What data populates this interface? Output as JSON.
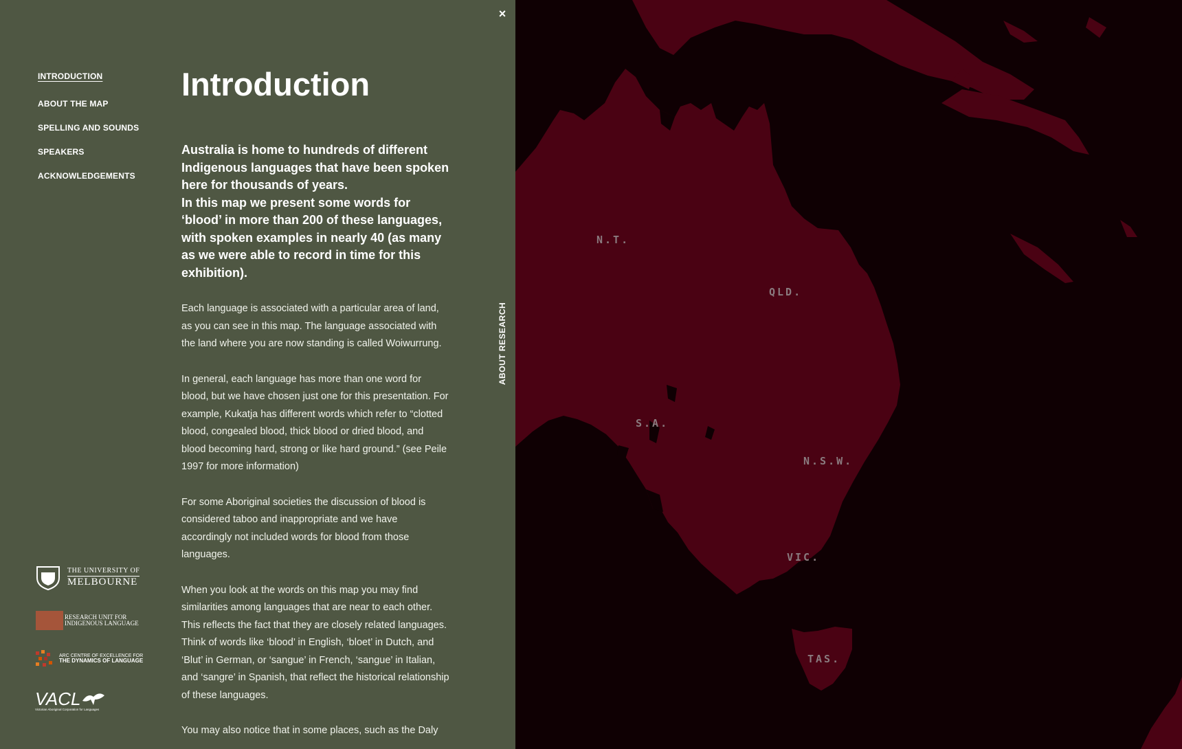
{
  "panel": {
    "close_label": "×",
    "vertical_tab_label": "ABOUT RESEARCH",
    "nav": [
      {
        "label": "INTRODUCTION",
        "active": true
      },
      {
        "label": "ABOUT THE MAP",
        "active": false
      },
      {
        "label": "SPELLING AND SOUNDS",
        "active": false
      },
      {
        "label": "SPEAKERS",
        "active": false
      },
      {
        "label": "ACKNOWLEDGEMENTS",
        "active": false
      }
    ],
    "title": "Introduction",
    "lead": [
      "Australia is home to hundreds of different Indigenous languages that have been spoken here for thousands of years.",
      "In this map we present some words for ‘blood’ in more than 200 of these languages, with spoken examples in nearly 40 (as many as we were able to record in time for this exhibition)."
    ],
    "paragraphs": [
      "Each language is associated with a particular area of land, as you can see in this map. The language associated with the land where you are now standing is called Woiwurrung.",
      "In general, each language has more than one word for blood, but we have chosen just one for this presentation. For example, Kukatja has different words which refer to “clotted blood, congealed blood, thick blood or dried blood, and blood becoming hard, strong or like hard ground.” (see Peile 1997 for more information)",
      "For some Aboriginal societies the discussion of blood is considered taboo and inappropriate and we have accordingly not included words for blood from those languages.",
      "When you look at the words on this map you may find similarities among languages that are near to each other. This reflects the fact that they are closely related languages. Think of words like ‘blood’ in English, ‘bloet’ in Dutch, and ‘Blut’ in German, or ‘sangue’ in French, ‘sangue’ in Italian, and ‘sangre’ in Spanish, that reflect the historical relationship of these languages.",
      "You may also notice that in some places, such as the Daly"
    ],
    "logos": {
      "melbourne": {
        "line1": "THE UNIVERSITY OF",
        "line2": "MELBOURNE"
      },
      "ruil": {
        "line1": "RESEARCH UNIT FOR",
        "line2": "INDIGENOUS LANGUAGE"
      },
      "arc": {
        "line1": "ARC CENTRE OF EXCELLENCE FOR",
        "line2": "THE DYNAMICS OF LANGUAGE"
      },
      "vacl": {
        "line1": "VACL",
        "line2": "Victorian Aboriginal Corporation for Languages"
      }
    }
  },
  "map": {
    "land_color": "#4a0213",
    "sea_color": "#0f0003",
    "state_labels": [
      "N.T.",
      "QLD.",
      "S.A.",
      "N.S.W.",
      "VIC.",
      "TAS."
    ]
  },
  "colors": {
    "panel_bg": "#4f5743",
    "text": "#ffffff"
  }
}
